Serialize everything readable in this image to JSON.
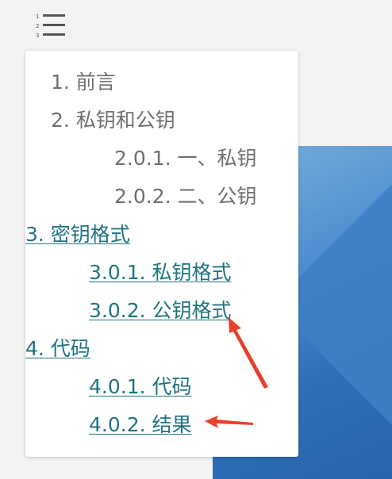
{
  "toc": {
    "toggle_icon": "numbered-list-icon",
    "items": [
      {
        "text": "1. 前言",
        "link": false
      },
      {
        "text": "2. 私钥和公钥",
        "link": false
      },
      {
        "text": "2.0.1. 一、私钥",
        "link": false
      },
      {
        "text": "2.0.2. 二、公钥",
        "link": false
      },
      {
        "text": "3. 密钥格式",
        "link": true
      },
      {
        "text": "3.0.1. 私钥格式",
        "link": true
      },
      {
        "text": "3.0.2. 公钥格式",
        "link": true
      },
      {
        "text": "4. 代码",
        "link": true
      },
      {
        "text": "4.0.1. 代码",
        "link": true
      },
      {
        "text": "4.0.2. 结果",
        "link": true
      }
    ]
  },
  "colors": {
    "link": "#1f7480",
    "muted_text": "#6f6f6f",
    "arrow": "#e8412c",
    "background_image": "#3a78c2"
  }
}
